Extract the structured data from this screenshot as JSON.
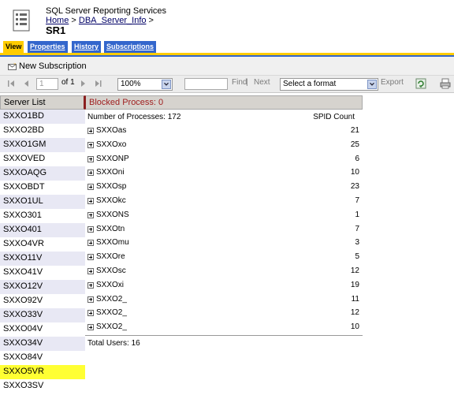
{
  "header": {
    "app_title": "SQL Server Reporting Services",
    "breadcrumb_home": "Home",
    "breadcrumb_sep1": " > ",
    "breadcrumb_folder": "DBA_Server_Info",
    "breadcrumb_sep2": " >",
    "report_title": "SR1"
  },
  "tabs": [
    "View",
    "Properties",
    "History",
    "Subscriptions"
  ],
  "subbar": {
    "new_subscription": "New Subscription"
  },
  "toolbar": {
    "page_value": "1",
    "page_of": "of 1",
    "zoom": "100%",
    "find": "Find",
    "find_sep": " | ",
    "next": "Next",
    "format": "Select a format",
    "export": "Export"
  },
  "server_list": {
    "header": "Server List",
    "items": [
      "SXXO1BD",
      "SXXO2BD",
      "SXXO1GM",
      "SXXOVED",
      "SXXOAQG",
      "SXXOBDT",
      "SXXO1UL",
      "SXXO301",
      "SXXO401",
      "SXXO4VR",
      "SXXO11V",
      "SXXO41V",
      "SXXO12V",
      "SXXO92V",
      "SXXO33V",
      "SXXO04V",
      "SXXO34V",
      "SXXO84V",
      "SXXO5VR",
      "SXXO3SV"
    ],
    "selected_index": 18
  },
  "report": {
    "blocked": "Blocked Process: 0",
    "num_processes": "Number of Processes: 172",
    "spid_count_label": "SPID Count",
    "rows": [
      {
        "name": "SXXOas",
        "count": "21"
      },
      {
        "name": "SXXOxo",
        "count": "25"
      },
      {
        "name": "SXXONP",
        "count": "6"
      },
      {
        "name": "SXXOni",
        "count": "10"
      },
      {
        "name": "SXXOsp",
        "count": "23"
      },
      {
        "name": "SXXOkc",
        "count": "7"
      },
      {
        "name": "SXXONS",
        "count": "1"
      },
      {
        "name": "SXXOtn",
        "count": "7"
      },
      {
        "name": "SXXOmu",
        "count": "3"
      },
      {
        "name": "SXXOre",
        "count": "5"
      },
      {
        "name": "SXXOsc",
        "count": "12"
      },
      {
        "name": "SXXOxi",
        "count": "19"
      },
      {
        "name": "SXXO2_",
        "count": "11"
      },
      {
        "name": "SXXO2_",
        "count": "12"
      },
      {
        "name": "SXXO2_",
        "count": "10"
      }
    ],
    "total_users": "Total Users: 16"
  },
  "colors": {
    "tab_active": "#ffcc00",
    "tab_inactive": "#3366cc",
    "selected_row": "#ffff33",
    "blocked_text": "#a02020"
  },
  "icons": [
    "report-icon",
    "new-subscription-icon",
    "first-page-icon",
    "prev-page-icon",
    "next-page-icon",
    "last-page-icon",
    "refresh-icon",
    "print-icon"
  ]
}
